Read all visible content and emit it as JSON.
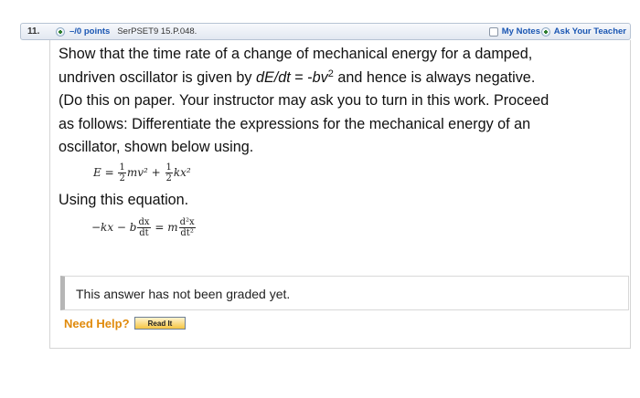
{
  "header": {
    "question_number": "11.",
    "points": "–/0 points",
    "source": "SerPSET9 15.P.048.",
    "my_notes": "My Notes",
    "ask_teacher": "Ask Your Teacher"
  },
  "question": {
    "line1": "Show that the time rate of a change of mechanical energy for a damped,",
    "line2_pre": "undriven oscillator is given by ",
    "line2_expr1": "dE/dt",
    "line2_mid": " = -",
    "line2_expr2": "bv",
    "line2_sup": "2",
    "line2_post": " and hence is always negative.",
    "line3": "(Do this on paper. Your instructor may ask you to turn in this work. Proceed",
    "line4": "as follows: Differentiate the expressions for the mechanical energy of an",
    "line5": "oscillator, shown below using."
  },
  "equation1": {
    "lhs": "E =",
    "frac1_num": "1",
    "frac1_den": "2",
    "term1": "mv² +",
    "frac2_num": "1",
    "frac2_den": "2",
    "term2": "kx²"
  },
  "using_text": "Using this equation.",
  "equation2": {
    "lhs": "−kx − b",
    "frac1_num": "dx",
    "frac1_den": "dt",
    "mid": "= m",
    "frac2_num": "d²x",
    "frac2_den": "dt²"
  },
  "answer": {
    "status": "This answer has not been graded yet."
  },
  "help": {
    "label": "Need Help?",
    "read_it": "Read It"
  },
  "colors": {
    "link": "#1a56b3",
    "need_help": "#e08a0b",
    "read_it_bg": "#f5c542"
  }
}
